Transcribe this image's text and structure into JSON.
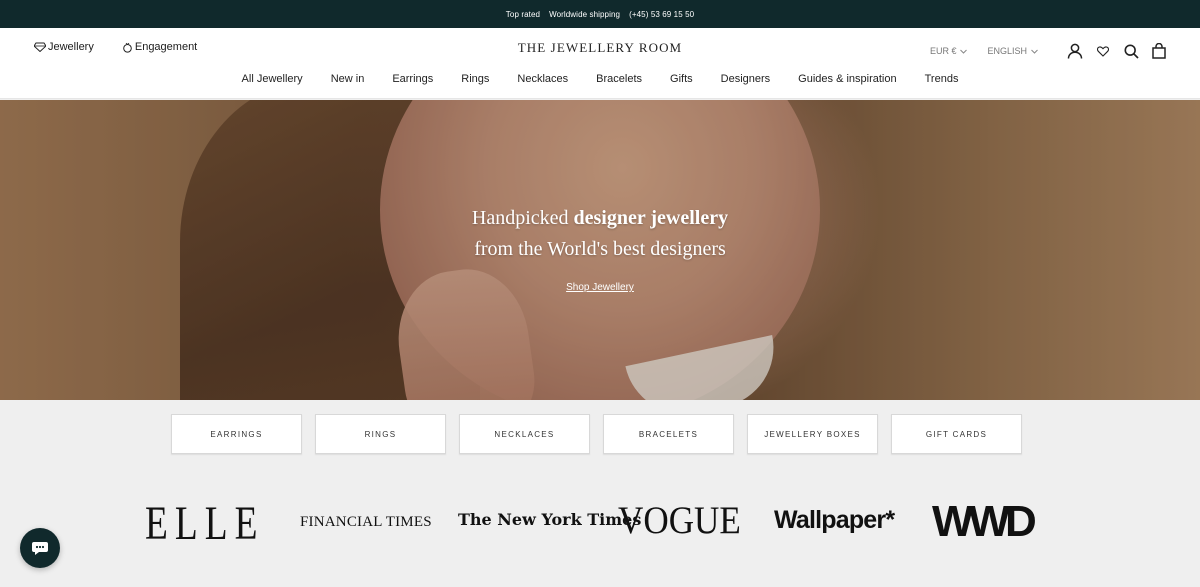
{
  "topbar": {
    "items": [
      "Top rated",
      "Worldwide shipping",
      "(+45) 53 69 15 50"
    ]
  },
  "header": {
    "left_links": [
      {
        "label": "Jewellery",
        "icon": "diamond-icon"
      },
      {
        "label": "Engagement",
        "icon": "ring-icon"
      }
    ],
    "logo": "THE JEWELLERY ROOM",
    "currency": "EUR €",
    "language": "ENGLISH",
    "icons": [
      "account-icon",
      "wishlist-icon",
      "search-icon",
      "cart-icon"
    ]
  },
  "nav": {
    "items": [
      "All Jewellery",
      "New in",
      "Earrings",
      "Rings",
      "Necklaces",
      "Bracelets",
      "Gifts",
      "Designers",
      "Guides & inspiration",
      "Trends"
    ]
  },
  "hero": {
    "line1_pre": "Handpicked ",
    "line1_bold": "designer jewellery",
    "line2": "from the World's best designers",
    "link": "Shop Jewellery"
  },
  "categories": [
    "EARRINGS",
    "RINGS",
    "NECKLACES",
    "BRACELETS",
    "JEWELLERY BOXES",
    "GIFT CARDS"
  ],
  "press": {
    "logos": [
      "ELLE",
      "FINANCIAL TIMES",
      "The New York Times",
      "VOGUE",
      "Wallpaper*",
      "WWD"
    ]
  },
  "colors": {
    "topbar_bg": "#10292c",
    "page_bg": "#efefef",
    "chat_bg": "#10292c"
  }
}
